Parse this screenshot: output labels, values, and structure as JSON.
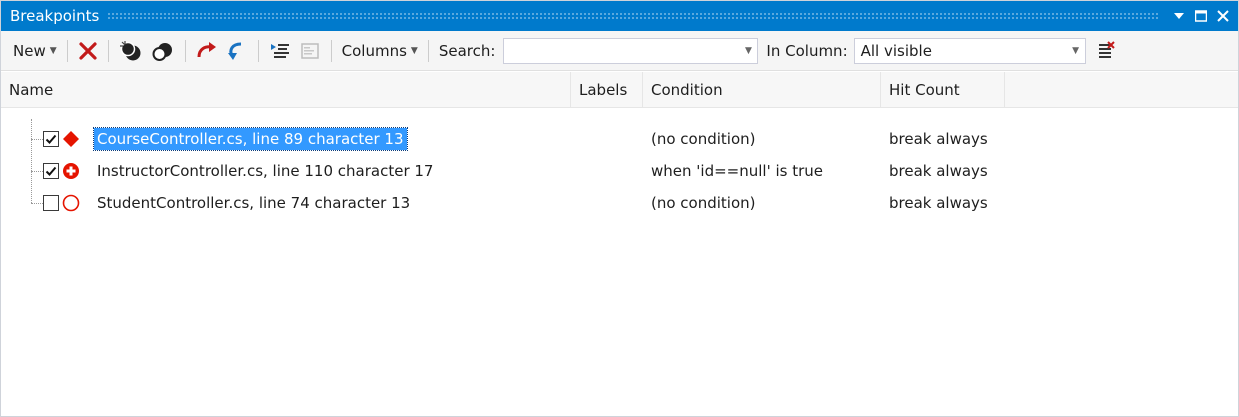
{
  "window": {
    "title": "Breakpoints",
    "controls": [
      "dropdown-icon",
      "maximize-icon",
      "close-icon"
    ]
  },
  "toolbar": {
    "new_label": "New",
    "columns_label": "Columns",
    "search_label": "Search:",
    "search_value": "",
    "in_column_label": "In Column:",
    "in_column_value": "All visible"
  },
  "columns": {
    "name": "Name",
    "labels": "Labels",
    "condition": "Condition",
    "hit_count": "Hit Count"
  },
  "breakpoints": [
    {
      "checked": true,
      "icon": "filled-diamond-icon",
      "name": "CourseController.cs, line 89 character 13",
      "labels": "",
      "condition": "(no condition)",
      "hit_count": "break always",
      "selected": true
    },
    {
      "checked": true,
      "icon": "conditional-breakpoint-icon",
      "name": "InstructorController.cs, line 110 character 17",
      "labels": "",
      "condition": "when 'id==null' is true",
      "hit_count": "break always",
      "selected": false
    },
    {
      "checked": false,
      "icon": "disabled-breakpoint-icon",
      "name": "StudentController.cs, line 74 character 13",
      "labels": "",
      "condition": "(no condition)",
      "hit_count": "break always",
      "selected": false
    }
  ],
  "colors": {
    "title_bar": "#007acc",
    "selection": "#3399ff",
    "breakpoint_red": "#e51400"
  }
}
